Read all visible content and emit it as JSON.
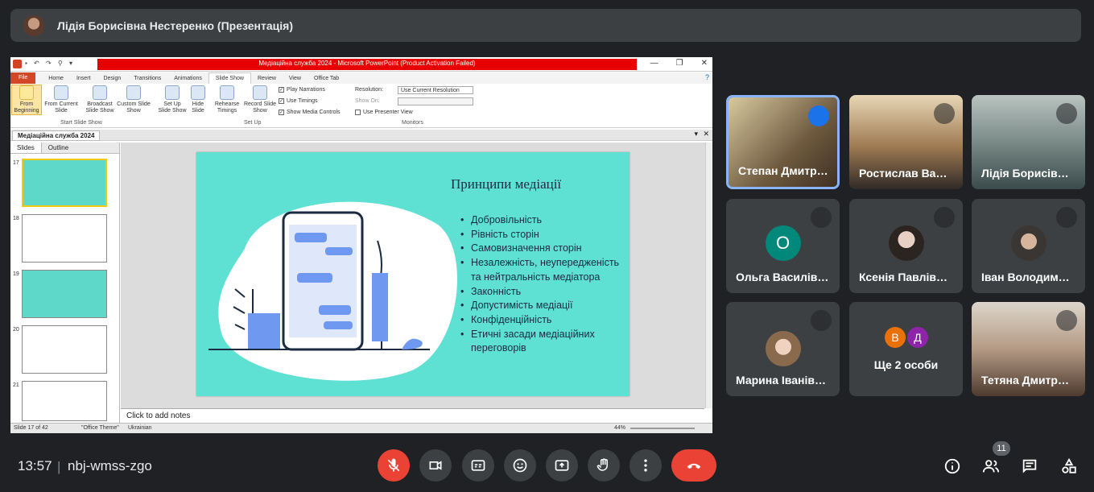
{
  "presenter": {
    "name": "Лідія Борисівна Нестеренко (Презентація)"
  },
  "powerpoint": {
    "window_title": "Медіаційна служба 2024  -  Microsoft PowerPoint (Product Activation Failed)",
    "file_tab": "File",
    "tabs": [
      "Home",
      "Insert",
      "Design",
      "Transitions",
      "Animations",
      "Slide Show",
      "Review",
      "View",
      "Office Tab"
    ],
    "ribbon": {
      "from_beginning": "From Beginning",
      "from_current": "From Current Slide",
      "broadcast": "Broadcast Slide Show",
      "custom": "Custom Slide Show",
      "group_start": "Start Slide Show",
      "setup": "Set Up Slide Show",
      "hide": "Hide Slide",
      "rehearse": "Rehearse Timings",
      "record": "Record Slide Show",
      "group_setup": "Set Up",
      "play_narrations": "Play Narrations",
      "use_timings": "Use Timings",
      "show_media": "Show Media Controls",
      "resolution_label": "Resolution:",
      "resolution_value": "Use Current Resolution",
      "show_on_label": "Show On:",
      "presenter_view": "Use Presenter View",
      "group_monitors": "Monitors"
    },
    "doc_tab": "Медіаційна служба 2024",
    "pane_tabs": [
      "Slides",
      "Outline"
    ],
    "slide_numbers": [
      "17",
      "18",
      "19",
      "20",
      "21"
    ],
    "notes_placeholder": "Click to add notes",
    "status": {
      "slide": "Slide 17 of 42",
      "theme": "\"Office Theme\"",
      "language": "Ukrainian",
      "zoom": "44%"
    },
    "slide": {
      "title": "Принципи медіації",
      "bullets": [
        "Добровільність",
        "Рівність сторін",
        "Самовизначення сторін",
        "Незалежність, неупередженість та нейтральність медіатора",
        "Законність",
        "Допустимість медіації",
        "Конфіденційність",
        "Етичні засади медіаційних переговорів"
      ]
    }
  },
  "participants": [
    {
      "name": "Степан Дмитр…",
      "speaking": true
    },
    {
      "name": "Ростислав Ва…"
    },
    {
      "name": "Лідія Борисів…"
    },
    {
      "name": "Ольга Василів…",
      "initial": "О",
      "color": "#00897b"
    },
    {
      "name": "Ксенія Павлів…"
    },
    {
      "name": "Іван Володим…"
    },
    {
      "name": "Марина Іванів…"
    },
    {
      "name": "Ще 2 особи",
      "initials": [
        "В",
        "Д"
      ]
    },
    {
      "name": "Тетяна Дмитр…"
    }
  ],
  "bottom": {
    "time": "13:57",
    "separator": "|",
    "meeting_code": "nbj-wmss-zgo",
    "participants_count": "11"
  },
  "colors": {
    "accent_blue": "#1a73e8",
    "end_call": "#ea4335",
    "slide_bg": "#5ee0d3"
  }
}
